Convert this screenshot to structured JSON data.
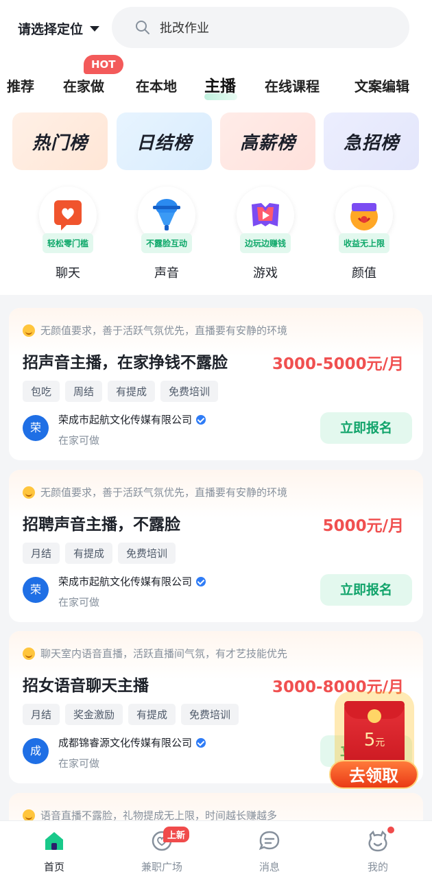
{
  "header": {
    "location": "请选择定位",
    "search_text": "批改作业"
  },
  "tabs": [
    {
      "label": "推荐"
    },
    {
      "label": "在家做",
      "badge": "HOT"
    },
    {
      "label": "在本地"
    },
    {
      "label": "主播",
      "active": true
    },
    {
      "label": "在线课程"
    },
    {
      "label": "文案编辑"
    }
  ],
  "rankings": [
    "热门榜",
    "日结榜",
    "高薪榜",
    "急招榜"
  ],
  "categories": [
    {
      "badge": "轻松零门槛",
      "label": "聊天",
      "icon": "chat-heart-icon"
    },
    {
      "badge": "不露脸互动",
      "label": "声音",
      "icon": "microphone-icon"
    },
    {
      "badge": "边玩边赚钱",
      "label": "游戏",
      "icon": "game-icon"
    },
    {
      "badge": "收益无上限",
      "label": "颜值",
      "icon": "face-icon"
    }
  ],
  "jobs": [
    {
      "hint": "无颜值要求，善于活跃气氛优先，直播要有安静的环境",
      "title": "招声音主播，在家挣钱不露脸",
      "salary": "3000-5000元/月",
      "tags": [
        "包吃",
        "周结",
        "有提成",
        "免费培训"
      ],
      "avatar": "荣",
      "company": "荣成市起航文化传媒有限公司",
      "location": "在家可做",
      "apply": "立即报名"
    },
    {
      "hint": "无颜值要求，善于活跃气氛优先，直播要有安静的环境",
      "title": "招聘声音主播，不露脸",
      "salary": "5000元/月",
      "tags": [
        "月结",
        "有提成",
        "免费培训"
      ],
      "avatar": "荣",
      "company": "荣成市起航文化传媒有限公司",
      "location": "在家可做",
      "apply": "立即报名"
    },
    {
      "hint": "聊天室内语音直播，活跃直播间气氛，有才艺技能优先",
      "title": "招女语音聊天主播",
      "salary": "3000-8000元/月",
      "tags": [
        "月结",
        "奖金激励",
        "有提成",
        "免费培训"
      ],
      "avatar": "成",
      "company": "成都锦睿源文化传媒有限公司",
      "location": "在家可做",
      "apply": "立即报名"
    },
    {
      "hint": "语音直播不露脸，礼物提成无上限，时间越长赚越多"
    }
  ],
  "red_packet": {
    "amount": "5",
    "unit": "元",
    "button": "去领取"
  },
  "bottom_nav": [
    {
      "label": "首页",
      "icon": "home-icon",
      "active": true
    },
    {
      "label": "兼职广场",
      "icon": "heart-chat-icon",
      "badge": "上新"
    },
    {
      "label": "消息",
      "icon": "message-icon"
    },
    {
      "label": "我的",
      "icon": "profile-icon"
    }
  ],
  "colors": {
    "accent": "#10a36a",
    "salary": "#f05050",
    "hot": "#f35a5a"
  }
}
